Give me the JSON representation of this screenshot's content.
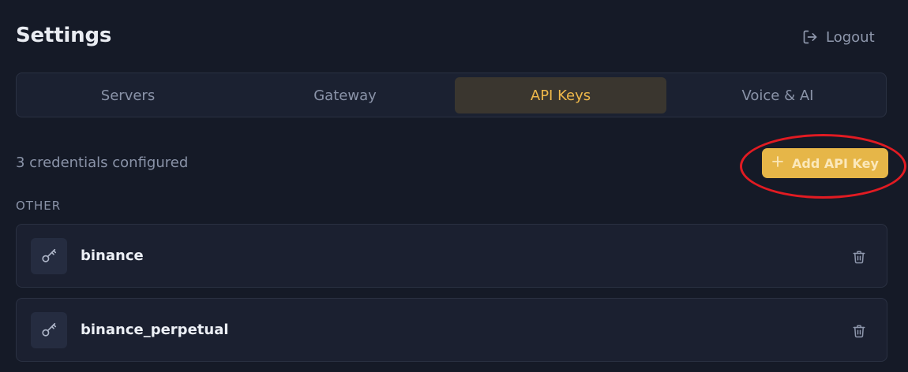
{
  "header": {
    "title": "Settings",
    "logout_label": "Logout",
    "logout_icon": "logout-icon"
  },
  "tabs": [
    {
      "label": "Servers",
      "active": false
    },
    {
      "label": "Gateway",
      "active": false
    },
    {
      "label": "API Keys",
      "active": true
    },
    {
      "label": "Voice & AI",
      "active": false
    }
  ],
  "api_keys": {
    "count_text": "3 credentials configured",
    "add_button_label": "Add API Key",
    "add_icon": "plus-icon",
    "section_label": "OTHER",
    "items": [
      {
        "name": "binance",
        "icon": "key-icon",
        "action_icon": "trash-icon"
      },
      {
        "name": "binance_perpetual",
        "icon": "key-icon",
        "action_icon": "trash-icon"
      }
    ]
  },
  "colors": {
    "background": "#151a27",
    "accent": "#e6b648",
    "annotation": "#e11b22"
  }
}
